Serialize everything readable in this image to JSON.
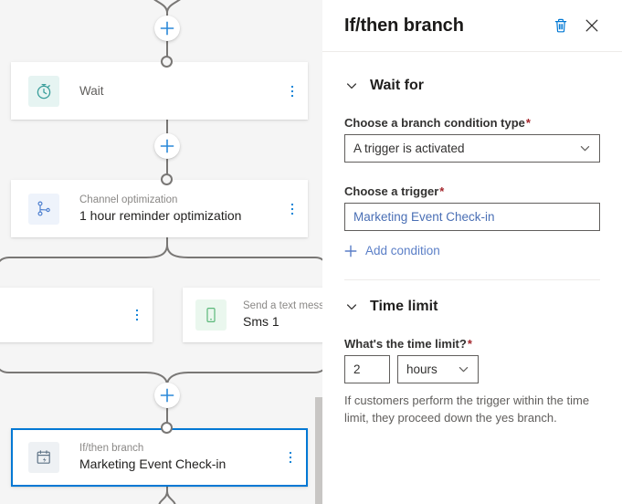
{
  "canvas": {
    "nodes": [
      {
        "id": "wait",
        "subtitle": "",
        "title": "Wait",
        "icon": "stopwatch-icon",
        "icon_color": "#3a9e9b",
        "icon_bg": "#e6f4f2"
      },
      {
        "id": "channel-optimization",
        "subtitle": "Channel optimization",
        "title": "1 hour reminder optimization",
        "icon": "branch-split-icon",
        "icon_color": "#4d7fcf",
        "icon_bg": "#eef3fb"
      },
      {
        "id": "sms",
        "subtitle": "Send a text mess",
        "title": "Sms 1",
        "icon": "mobile-phone-icon",
        "icon_color": "#5bb87a",
        "icon_bg": "#eaf7ee"
      },
      {
        "id": "if-then-branch",
        "subtitle": "If/then branch",
        "title": "Marketing Event Check-in",
        "icon": "calendar-event-icon",
        "icon_color": "#5d7285",
        "icon_bg": "#eef1f4"
      }
    ],
    "add_step_label": "+",
    "menu_label": "More options"
  },
  "panel": {
    "header": {
      "title": "If/then branch",
      "delete_icon": "trash-icon",
      "close_icon": "close-icon",
      "accent_color": "#0078d4"
    },
    "sections": [
      {
        "id": "wait-for",
        "title": "Wait for",
        "expanded": true,
        "fields": {
          "condition_type": {
            "label": "Choose a branch condition type",
            "required": "*",
            "value": "A trigger is activated"
          },
          "trigger": {
            "label": "Choose a trigger",
            "required": "*",
            "value": "Marketing Event Check-in"
          },
          "add_condition": {
            "label": "Add condition",
            "icon": "plus-icon"
          }
        }
      },
      {
        "id": "time-limit",
        "title": "Time limit",
        "expanded": true,
        "fields": {
          "time_limit": {
            "label": "What's the time limit?",
            "required": "*",
            "amount": "2",
            "unit": "hours"
          },
          "help": "If customers perform the trigger within the time limit, they proceed down the yes branch."
        }
      }
    ]
  }
}
